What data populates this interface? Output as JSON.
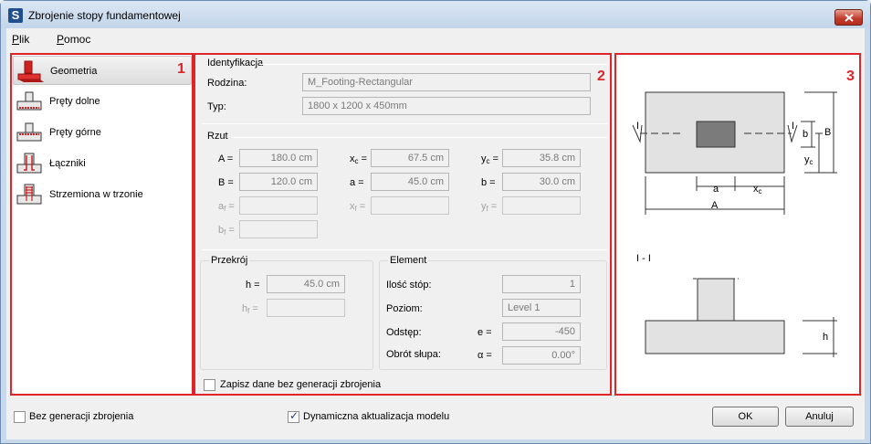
{
  "window": {
    "title": "Zbrojenie stopy fundamentowej",
    "app_icon": "S"
  },
  "menu": [
    {
      "label": "Plik",
      "mnemonic": "P",
      "rest": "lik"
    },
    {
      "label": "Pomoc",
      "mnemonic": "P",
      "rest": "omoc"
    }
  ],
  "panels": {
    "left_num": "1",
    "middle_num": "2",
    "right_num": "3"
  },
  "nav": [
    {
      "label": "Geometria",
      "icon": "footing-geometry-icon",
      "selected": true
    },
    {
      "label": "Pręty dolne",
      "icon": "bottom-bars-icon",
      "selected": false
    },
    {
      "label": "Pręty górne",
      "icon": "top-bars-icon",
      "selected": false
    },
    {
      "label": "Łączniki",
      "icon": "dowels-icon",
      "selected": false
    },
    {
      "label": "Strzemiona w trzonie",
      "icon": "stirrups-icon",
      "selected": false
    }
  ],
  "identification": {
    "title": "Identyfikacja",
    "family_label": "Rodzina:",
    "family_value": "M_Footing-Rectangular",
    "type_label": "Typ:",
    "type_value": "1800 x 1200 x 450mm"
  },
  "plan": {
    "title": "Rzut",
    "A_label": "A =",
    "A_value": "180.0 cm",
    "B_label": "B =",
    "B_value": "120.0 cm",
    "af_label": "a",
    "af_sub": "f",
    "af_eq": "=",
    "bf_label": "b",
    "bf_sub": "f",
    "bf_eq": "=",
    "xc_label": "x",
    "xc_sub": "c",
    "xc_eq": "=",
    "xc_value": "67.5 cm",
    "a_label": "a =",
    "a_value": "45.0 cm",
    "xf_label": "x",
    "xf_sub": "f",
    "xf_eq": "=",
    "yc_label": "y",
    "yc_sub": "c",
    "yc_eq": "=",
    "yc_value": "35.8 cm",
    "b_label": "b =",
    "b_value": "30.0 cm",
    "yf_label": "y",
    "yf_sub": "f",
    "yf_eq": "="
  },
  "section": {
    "title": "Przekrój",
    "h_label": "h =",
    "h_value": "45.0 cm",
    "hf_label": "h",
    "hf_sub": "f",
    "hf_eq": "="
  },
  "element": {
    "title": "Element",
    "count_label": "Ilość stóp:",
    "count_value": "1",
    "level_label": "Poziom:",
    "level_value": "Level 1",
    "offset_label": "Odstęp:",
    "offset_sym": "e =",
    "offset_value": "-450",
    "rotation_label": "Obrót słupa:",
    "rotation_sym": "α =",
    "rotation_value": "0.00°"
  },
  "save_without_checkbox": {
    "label": "Zapisz dane bez generacji zbrojenia",
    "checked": false
  },
  "drawing": {
    "plan_labels": {
      "section_mark": "I",
      "b": "b",
      "B": "B",
      "yc": "y",
      "yc_sub": "c",
      "a": "a",
      "xc": "x",
      "xc_sub": "c",
      "A": "A"
    },
    "section_title": "I - I",
    "h": "h"
  },
  "footer": {
    "no_generation": {
      "label": "Bez generacji zbrojenia",
      "checked": false
    },
    "dynamic_update": {
      "label": "Dynamiczna aktualizacja modelu",
      "checked": true
    },
    "ok_label": "OK",
    "cancel_label": "Anuluj"
  },
  "colors": {
    "highlight_red": "#e0242a",
    "footing_fill": "#e2e2e2",
    "column_fill": "#7b7b7b"
  }
}
